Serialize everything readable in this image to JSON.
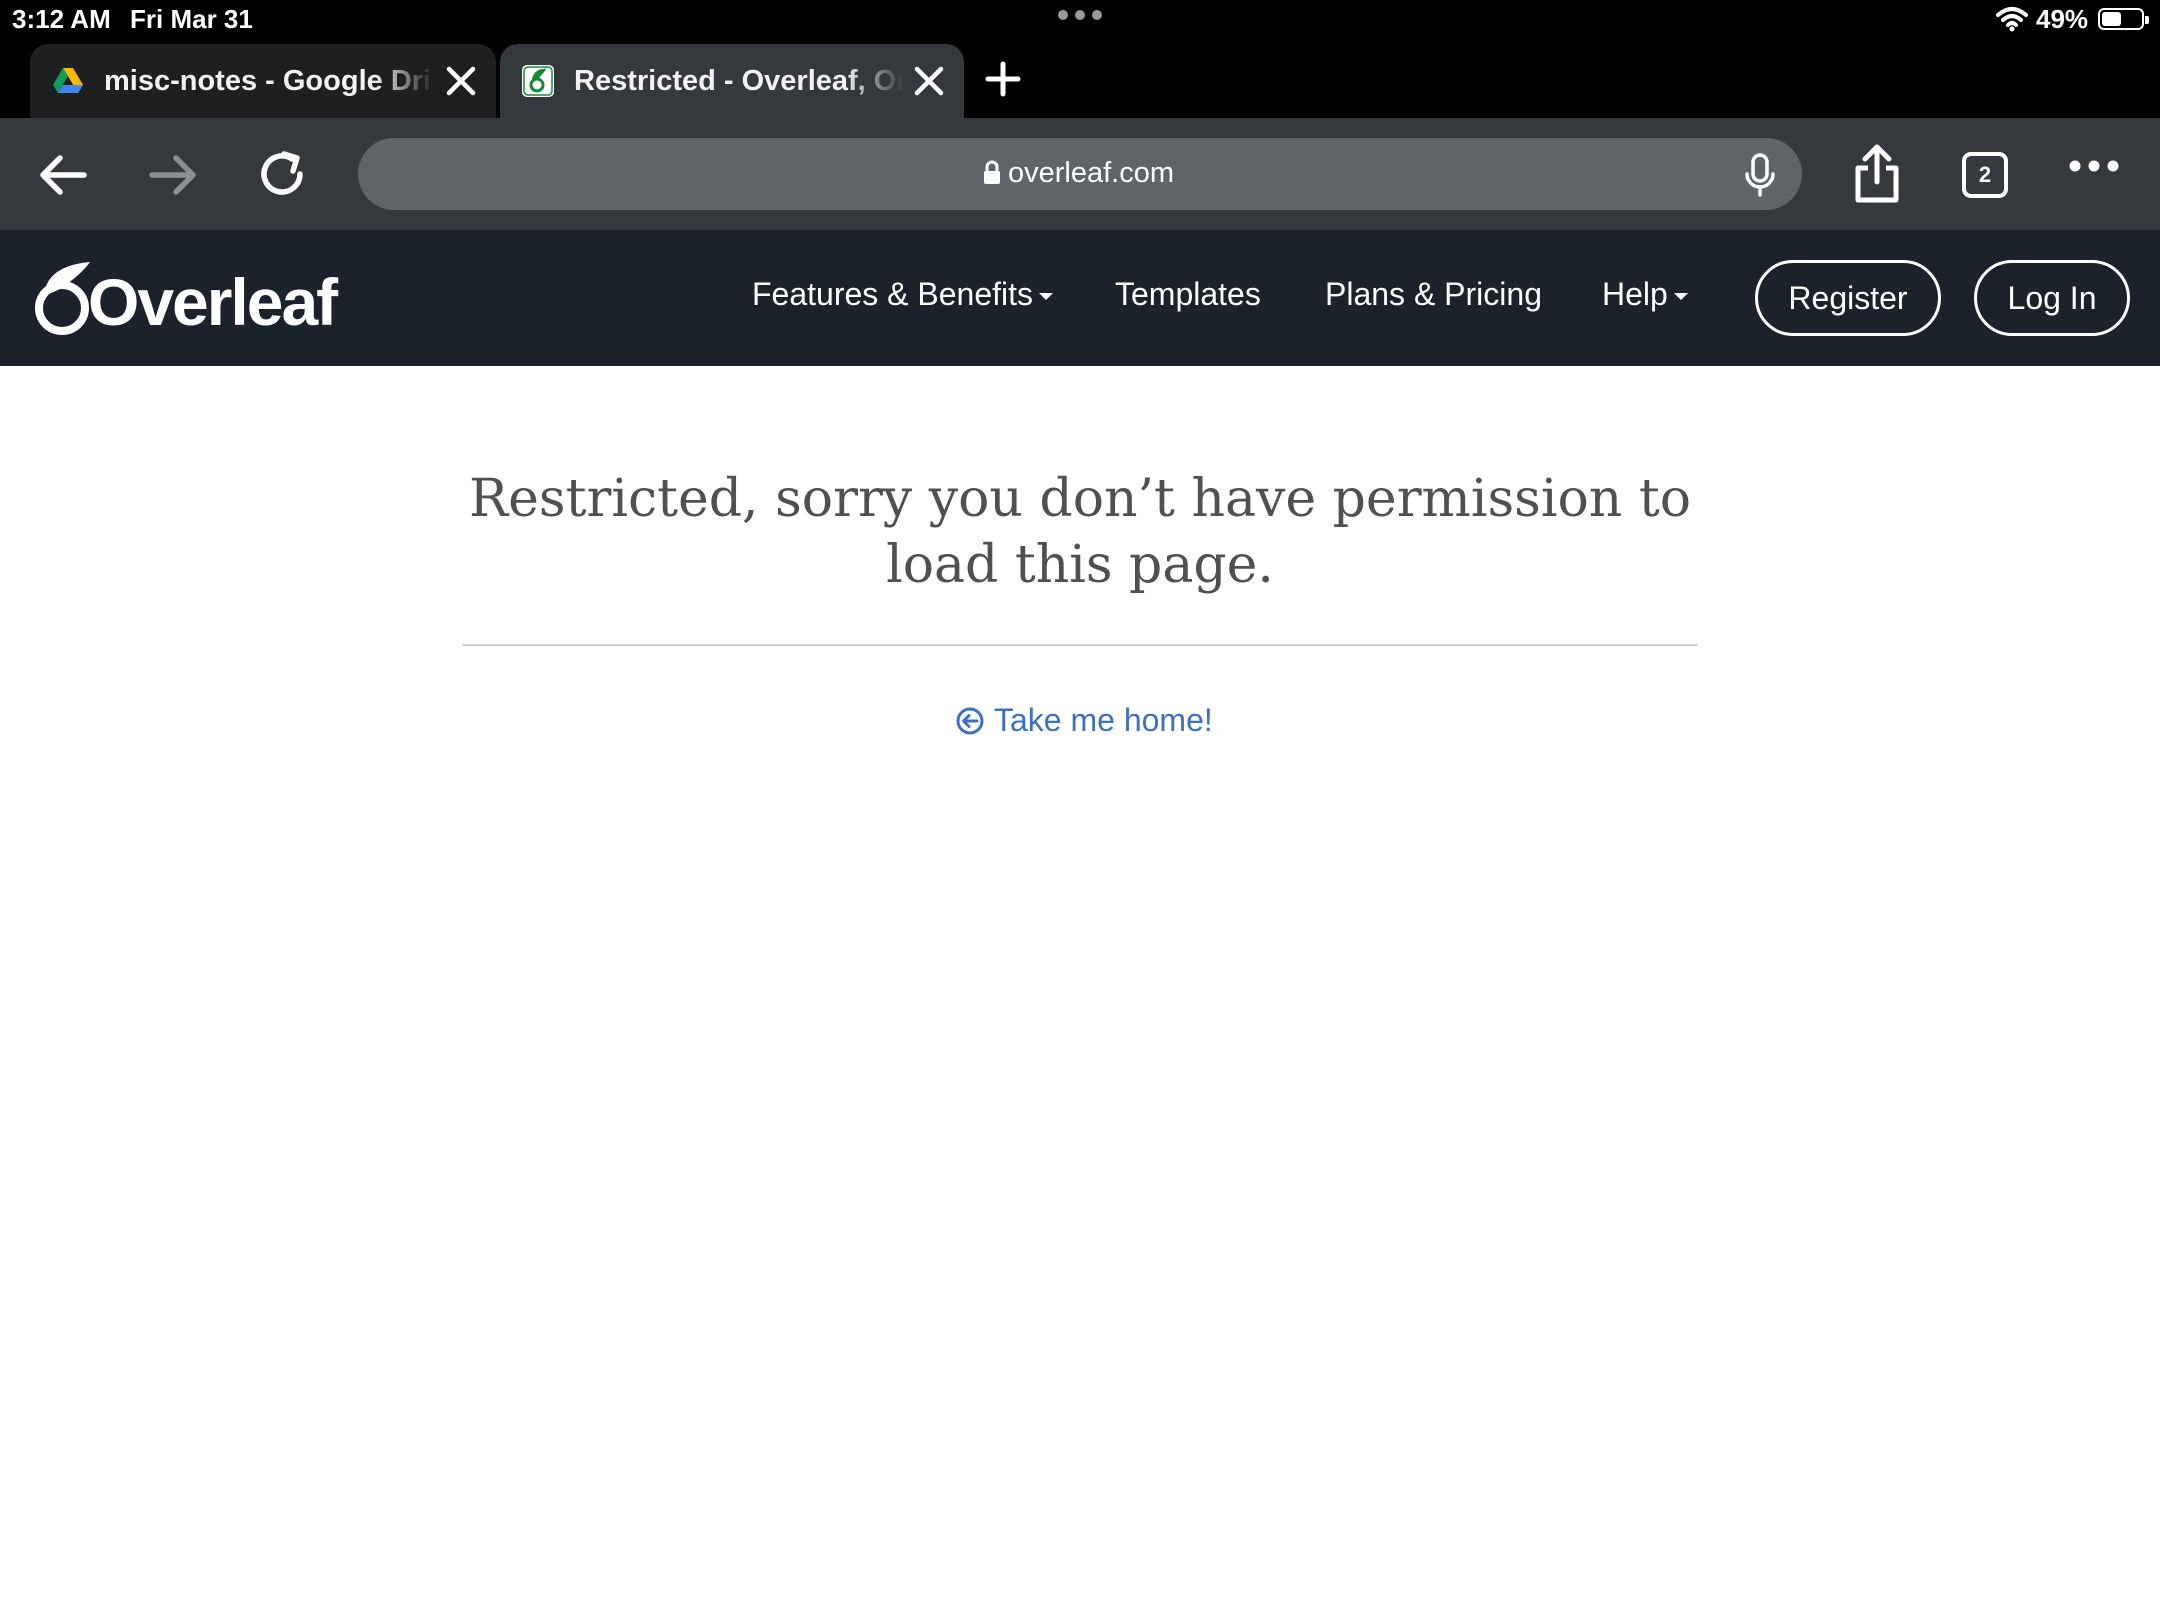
{
  "status_bar": {
    "time": "3:12 AM",
    "date": "Fri Mar 31",
    "battery_percent": "49%",
    "battery_level": 0.49
  },
  "tabs": [
    {
      "title": "misc-notes - Google Drive",
      "favicon": "google-drive-icon",
      "active": false
    },
    {
      "title": "Restricted - Overleaf, Online LaTeX Editor",
      "favicon": "overleaf-icon",
      "active": true
    }
  ],
  "toolbar": {
    "url": "overleaf.com",
    "tab_count": "2"
  },
  "site_nav": {
    "brand": "Overleaf",
    "links": {
      "features": "Features & Benefits",
      "templates": "Templates",
      "plans": "Plans & Pricing",
      "help": "Help"
    },
    "register": "Register",
    "login": "Log In"
  },
  "content": {
    "heading": "Restricted, sorry you don’t have permission to load this page.",
    "home_link": "Take me home!"
  },
  "colors": {
    "nav_background": "#1b222c",
    "link": "#3e70bb",
    "toolbar": "#35383c"
  }
}
